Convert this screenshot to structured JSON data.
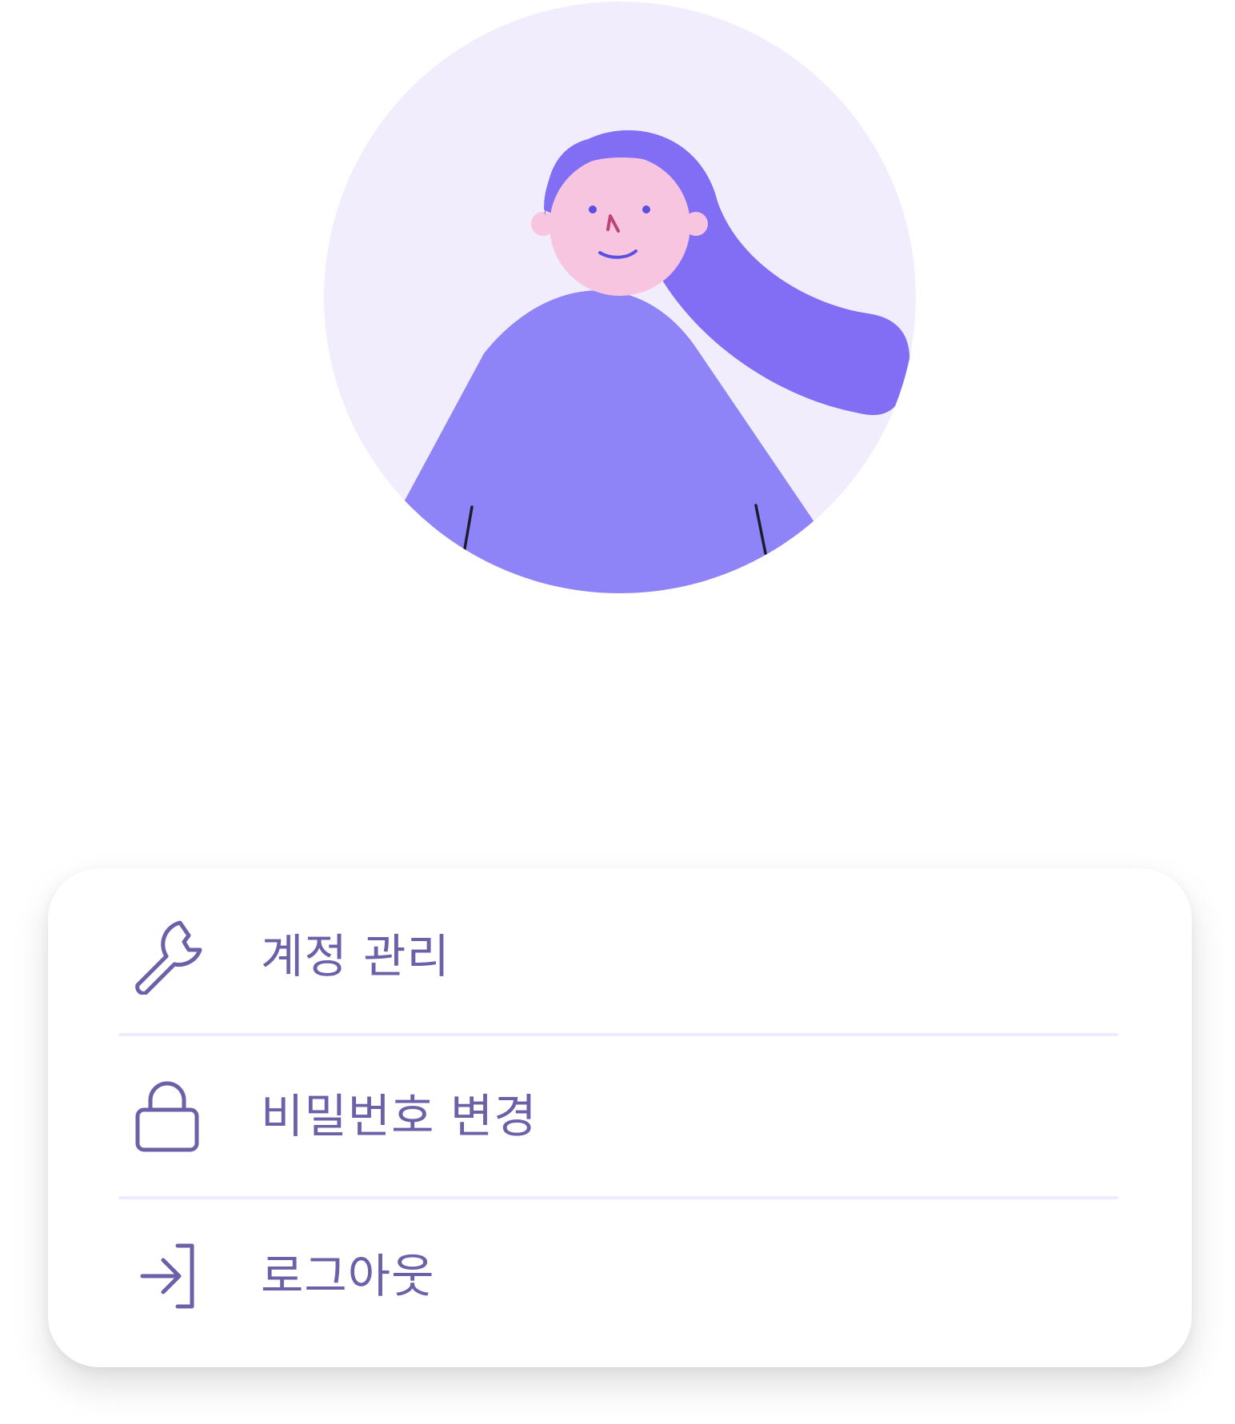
{
  "profile": {
    "avatar_icon": "woman-avatar-illustration"
  },
  "colors": {
    "accent": "#6a61a9",
    "divider": "#eeebfd",
    "avatar_bg": "#f1edfd",
    "hair": "#816ef5",
    "body": "#8e84f8",
    "skin": "#f7c5e0"
  },
  "menu": {
    "items": [
      {
        "icon": "wrench-icon",
        "label": "계정 관리"
      },
      {
        "icon": "lock-icon",
        "label": "비밀번호 변경"
      },
      {
        "icon": "logout-icon",
        "label": "로그아웃"
      }
    ]
  }
}
